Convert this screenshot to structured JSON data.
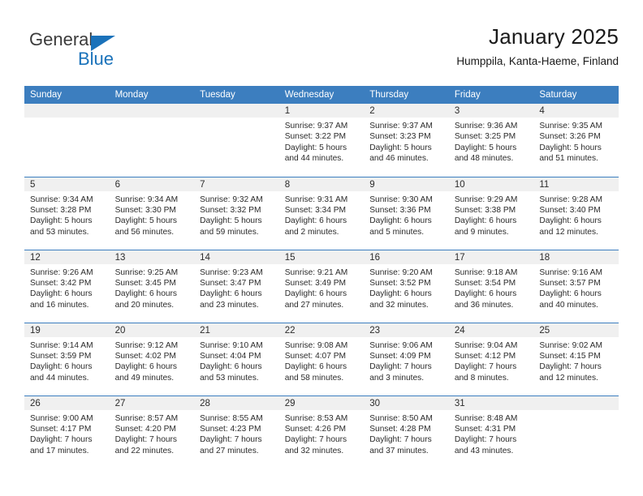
{
  "brand": {
    "name_top": "General",
    "name_bottom": "Blue",
    "color_blue": "#1a72ba",
    "color_dark": "#3b3b3b"
  },
  "header": {
    "title": "January 2025",
    "subtitle": "Humppila, Kanta-Haeme, Finland"
  },
  "theme": {
    "header_blue": "#3c7ebf",
    "daynum_band": "#f0f0f0",
    "text": "#2b2b2b"
  },
  "calendar": {
    "weekday_headers": [
      "Sunday",
      "Monday",
      "Tuesday",
      "Wednesday",
      "Thursday",
      "Friday",
      "Saturday"
    ],
    "weeks": [
      [
        {
          "day": "",
          "lines": []
        },
        {
          "day": "",
          "lines": []
        },
        {
          "day": "",
          "lines": []
        },
        {
          "day": "1",
          "lines": [
            "Sunrise: 9:37 AM",
            "Sunset: 3:22 PM",
            "Daylight: 5 hours",
            "and 44 minutes."
          ]
        },
        {
          "day": "2",
          "lines": [
            "Sunrise: 9:37 AM",
            "Sunset: 3:23 PM",
            "Daylight: 5 hours",
            "and 46 minutes."
          ]
        },
        {
          "day": "3",
          "lines": [
            "Sunrise: 9:36 AM",
            "Sunset: 3:25 PM",
            "Daylight: 5 hours",
            "and 48 minutes."
          ]
        },
        {
          "day": "4",
          "lines": [
            "Sunrise: 9:35 AM",
            "Sunset: 3:26 PM",
            "Daylight: 5 hours",
            "and 51 minutes."
          ]
        }
      ],
      [
        {
          "day": "5",
          "lines": [
            "Sunrise: 9:34 AM",
            "Sunset: 3:28 PM",
            "Daylight: 5 hours",
            "and 53 minutes."
          ]
        },
        {
          "day": "6",
          "lines": [
            "Sunrise: 9:34 AM",
            "Sunset: 3:30 PM",
            "Daylight: 5 hours",
            "and 56 minutes."
          ]
        },
        {
          "day": "7",
          "lines": [
            "Sunrise: 9:32 AM",
            "Sunset: 3:32 PM",
            "Daylight: 5 hours",
            "and 59 minutes."
          ]
        },
        {
          "day": "8",
          "lines": [
            "Sunrise: 9:31 AM",
            "Sunset: 3:34 PM",
            "Daylight: 6 hours",
            "and 2 minutes."
          ]
        },
        {
          "day": "9",
          "lines": [
            "Sunrise: 9:30 AM",
            "Sunset: 3:36 PM",
            "Daylight: 6 hours",
            "and 5 minutes."
          ]
        },
        {
          "day": "10",
          "lines": [
            "Sunrise: 9:29 AM",
            "Sunset: 3:38 PM",
            "Daylight: 6 hours",
            "and 9 minutes."
          ]
        },
        {
          "day": "11",
          "lines": [
            "Sunrise: 9:28 AM",
            "Sunset: 3:40 PM",
            "Daylight: 6 hours",
            "and 12 minutes."
          ]
        }
      ],
      [
        {
          "day": "12",
          "lines": [
            "Sunrise: 9:26 AM",
            "Sunset: 3:42 PM",
            "Daylight: 6 hours",
            "and 16 minutes."
          ]
        },
        {
          "day": "13",
          "lines": [
            "Sunrise: 9:25 AM",
            "Sunset: 3:45 PM",
            "Daylight: 6 hours",
            "and 20 minutes."
          ]
        },
        {
          "day": "14",
          "lines": [
            "Sunrise: 9:23 AM",
            "Sunset: 3:47 PM",
            "Daylight: 6 hours",
            "and 23 minutes."
          ]
        },
        {
          "day": "15",
          "lines": [
            "Sunrise: 9:21 AM",
            "Sunset: 3:49 PM",
            "Daylight: 6 hours",
            "and 27 minutes."
          ]
        },
        {
          "day": "16",
          "lines": [
            "Sunrise: 9:20 AM",
            "Sunset: 3:52 PM",
            "Daylight: 6 hours",
            "and 32 minutes."
          ]
        },
        {
          "day": "17",
          "lines": [
            "Sunrise: 9:18 AM",
            "Sunset: 3:54 PM",
            "Daylight: 6 hours",
            "and 36 minutes."
          ]
        },
        {
          "day": "18",
          "lines": [
            "Sunrise: 9:16 AM",
            "Sunset: 3:57 PM",
            "Daylight: 6 hours",
            "and 40 minutes."
          ]
        }
      ],
      [
        {
          "day": "19",
          "lines": [
            "Sunrise: 9:14 AM",
            "Sunset: 3:59 PM",
            "Daylight: 6 hours",
            "and 44 minutes."
          ]
        },
        {
          "day": "20",
          "lines": [
            "Sunrise: 9:12 AM",
            "Sunset: 4:02 PM",
            "Daylight: 6 hours",
            "and 49 minutes."
          ]
        },
        {
          "day": "21",
          "lines": [
            "Sunrise: 9:10 AM",
            "Sunset: 4:04 PM",
            "Daylight: 6 hours",
            "and 53 minutes."
          ]
        },
        {
          "day": "22",
          "lines": [
            "Sunrise: 9:08 AM",
            "Sunset: 4:07 PM",
            "Daylight: 6 hours",
            "and 58 minutes."
          ]
        },
        {
          "day": "23",
          "lines": [
            "Sunrise: 9:06 AM",
            "Sunset: 4:09 PM",
            "Daylight: 7 hours",
            "and 3 minutes."
          ]
        },
        {
          "day": "24",
          "lines": [
            "Sunrise: 9:04 AM",
            "Sunset: 4:12 PM",
            "Daylight: 7 hours",
            "and 8 minutes."
          ]
        },
        {
          "day": "25",
          "lines": [
            "Sunrise: 9:02 AM",
            "Sunset: 4:15 PM",
            "Daylight: 7 hours",
            "and 12 minutes."
          ]
        }
      ],
      [
        {
          "day": "26",
          "lines": [
            "Sunrise: 9:00 AM",
            "Sunset: 4:17 PM",
            "Daylight: 7 hours",
            "and 17 minutes."
          ]
        },
        {
          "day": "27",
          "lines": [
            "Sunrise: 8:57 AM",
            "Sunset: 4:20 PM",
            "Daylight: 7 hours",
            "and 22 minutes."
          ]
        },
        {
          "day": "28",
          "lines": [
            "Sunrise: 8:55 AM",
            "Sunset: 4:23 PM",
            "Daylight: 7 hours",
            "and 27 minutes."
          ]
        },
        {
          "day": "29",
          "lines": [
            "Sunrise: 8:53 AM",
            "Sunset: 4:26 PM",
            "Daylight: 7 hours",
            "and 32 minutes."
          ]
        },
        {
          "day": "30",
          "lines": [
            "Sunrise: 8:50 AM",
            "Sunset: 4:28 PM",
            "Daylight: 7 hours",
            "and 37 minutes."
          ]
        },
        {
          "day": "31",
          "lines": [
            "Sunrise: 8:48 AM",
            "Sunset: 4:31 PM",
            "Daylight: 7 hours",
            "and 43 minutes."
          ]
        },
        {
          "day": "",
          "lines": []
        }
      ]
    ]
  }
}
